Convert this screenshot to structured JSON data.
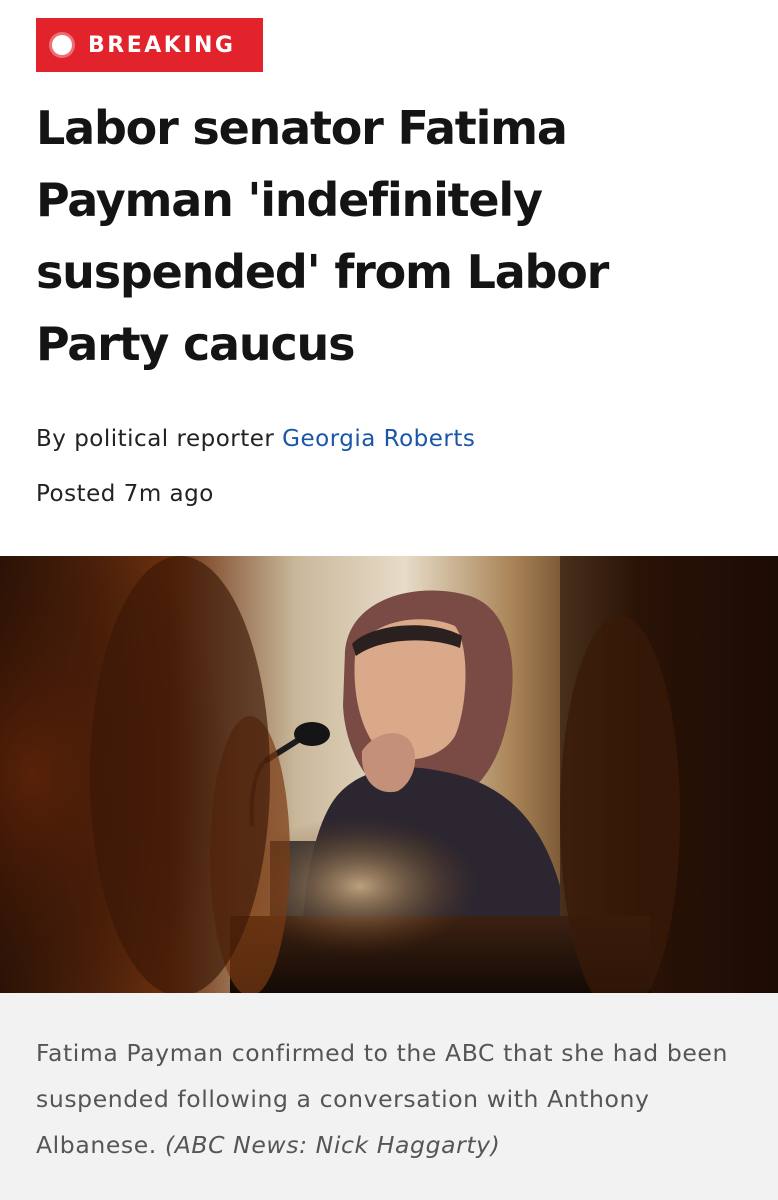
{
  "badge": {
    "label": "BREAKING",
    "color": "#e2232c"
  },
  "article": {
    "headline": "Labor senator Fatima Payman 'indefinitely suspended' from Labor Party caucus",
    "byline_prefix": "By political reporter",
    "author": "Georgia Roberts",
    "posted": "Posted 7m ago",
    "author_link_color": "#1a56a8"
  },
  "photo": {
    "caption": "Fatima Payman confirmed to the ABC that she had been suspended following a conversation with Anthony Albanese.",
    "credit": "(ABC News: Nick Haggarty)"
  }
}
